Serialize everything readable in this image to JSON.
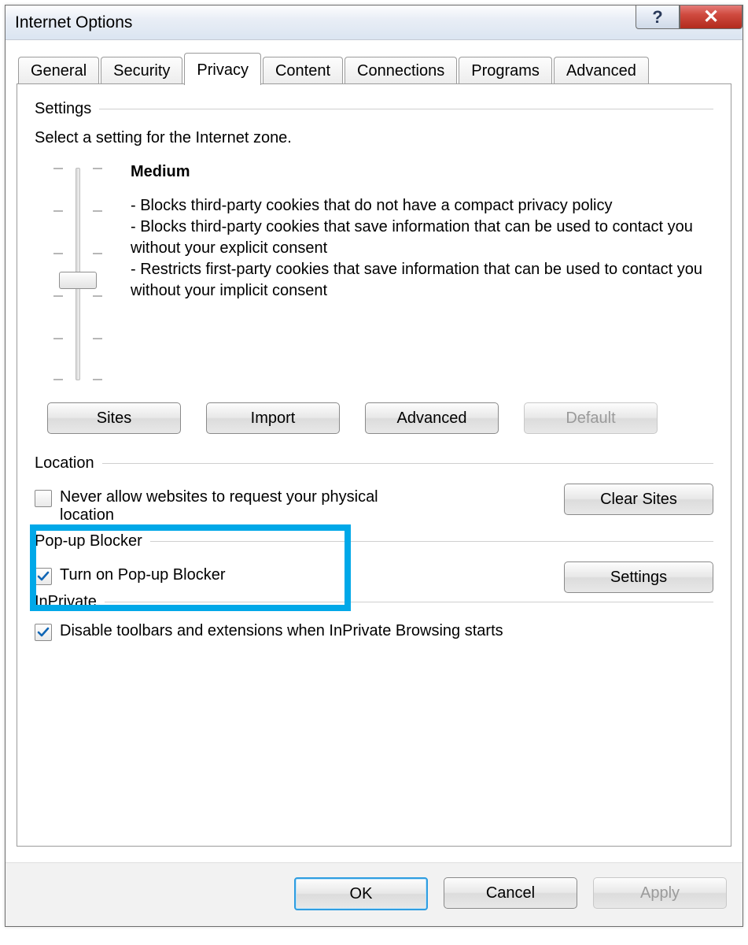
{
  "title": "Internet Options",
  "tabs": {
    "general": "General",
    "security": "Security",
    "privacy": "Privacy",
    "content": "Content",
    "connections": "Connections",
    "programs": "Programs",
    "advanced": "Advanced"
  },
  "settings": {
    "header": "Settings",
    "instruction": "Select a setting for the Internet zone.",
    "level_name": "Medium",
    "bullet1": "- Blocks third-party cookies that do not have a compact privacy policy",
    "bullet2": "- Blocks third-party cookies that save information that can be used to contact you without your explicit consent",
    "bullet3": "- Restricts first-party cookies that save information that can be used to contact you without your implicit consent",
    "btn_sites": "Sites",
    "btn_import": "Import",
    "btn_advanced": "Advanced",
    "btn_default": "Default"
  },
  "location": {
    "header": "Location",
    "chk_label": "Never allow websites to request your physical location",
    "chk_checked": false,
    "btn_clear": "Clear Sites"
  },
  "popup": {
    "header": "Pop-up Blocker",
    "chk_label": "Turn on Pop-up Blocker",
    "chk_checked": true,
    "btn_settings": "Settings"
  },
  "inprivate": {
    "header": "InPrivate",
    "chk_label": "Disable toolbars and extensions when InPrivate Browsing starts",
    "chk_checked": true
  },
  "buttons": {
    "ok": "OK",
    "cancel": "Cancel",
    "apply": "Apply"
  }
}
